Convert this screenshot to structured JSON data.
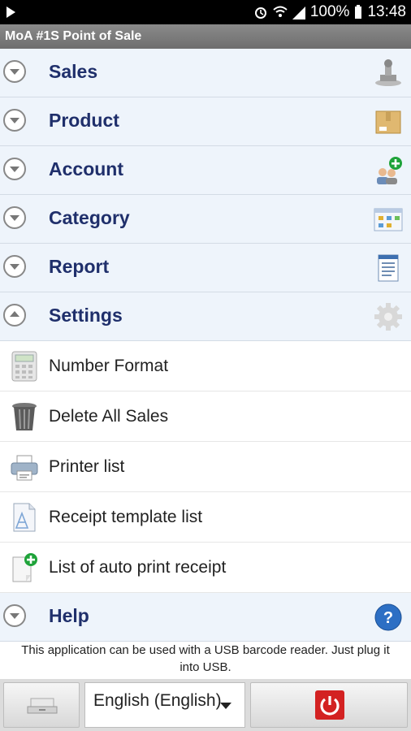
{
  "status_bar": {
    "battery": "100%",
    "time": "13:48"
  },
  "app": {
    "title": "MoA #1S Point of Sale"
  },
  "sections": [
    {
      "label": "Sales",
      "icon": "stamp-icon"
    },
    {
      "label": "Product",
      "icon": "box-icon"
    },
    {
      "label": "Account",
      "icon": "users-add-icon"
    },
    {
      "label": "Category",
      "icon": "category-grid-icon"
    },
    {
      "label": "Report",
      "icon": "document-icon"
    },
    {
      "label": "Settings",
      "icon": "gear-icon",
      "expanded": true
    },
    {
      "label": "Help",
      "icon": "help-icon"
    }
  ],
  "settings_items": [
    {
      "label": "Number Format",
      "icon": "calculator-icon"
    },
    {
      "label": "Delete All Sales",
      "icon": "trash-icon"
    },
    {
      "label": "Printer list",
      "icon": "printer-icon"
    },
    {
      "label": "Receipt template list",
      "icon": "receipt-template-icon"
    },
    {
      "label": "List of auto print receipt",
      "icon": "auto-print-icon"
    }
  ],
  "info_text": "This application can be used with a USB barcode reader. Just plug it into USB.",
  "bottom": {
    "language_value": "English (English)"
  },
  "colors": {
    "section_bg": "#eef4fb",
    "section_text": "#1f2f6b",
    "power_red": "#d32222"
  }
}
